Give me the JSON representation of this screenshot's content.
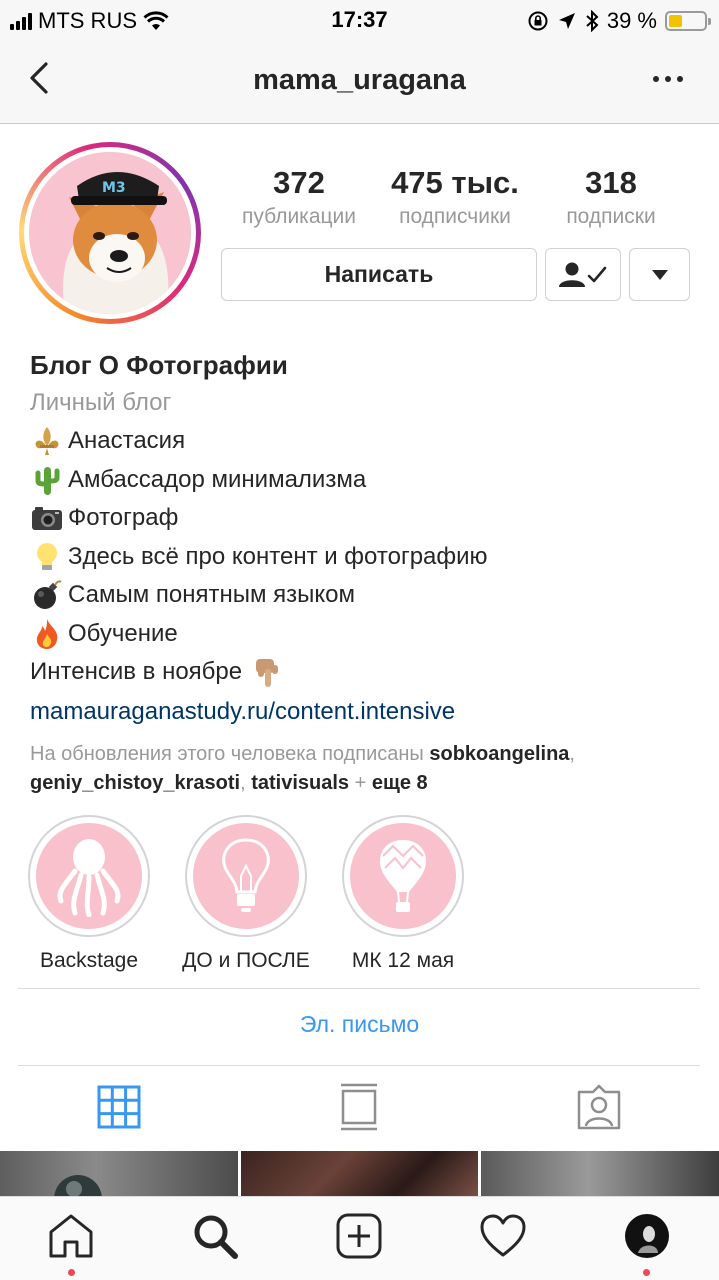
{
  "status_bar": {
    "carrier": "MTS RUS",
    "time": "17:37",
    "battery": "39 %",
    "battery_level": 0.39
  },
  "header": {
    "username": "mama_uragana"
  },
  "profile": {
    "stats": [
      {
        "value": "372",
        "label": "публикации"
      },
      {
        "value": "475 тыс.",
        "label": "подписчики"
      },
      {
        "value": "318",
        "label": "подписки"
      }
    ],
    "message_button": "Написать"
  },
  "bio": {
    "name": "Блог О Фотографии",
    "category": "Личный блог",
    "lines": [
      "Анастасия",
      "Амбассадор минимализма",
      "Фотограф",
      "Здесь всё про контент и фотографию",
      "Самым понятным языком",
      "Обучение",
      "Интенсив в ноябре"
    ],
    "link": "mamauraganastudy.ru/content.intensive",
    "followed_by": {
      "prefix": "На обновления этого человека подписаны",
      "user1": "sobkoangelina",
      "user2": "geniy_chistoy_krasoti",
      "user3": "tativisuals",
      "plus": "+",
      "more": "еще 8"
    }
  },
  "highlights": [
    {
      "label": "Backstage",
      "icon": "octopus-icon"
    },
    {
      "label": "ДО и ПОСЛЕ",
      "icon": "lightbulb-icon"
    },
    {
      "label": "МК 12 мая",
      "icon": "hot-air-balloon-icon"
    }
  ],
  "email_button": "Эл. письмо",
  "colors": {
    "link": "#003569",
    "accent": "#3897f0",
    "highlight_bg": "#f8c1cc",
    "notification_dot": "#ed4956"
  }
}
